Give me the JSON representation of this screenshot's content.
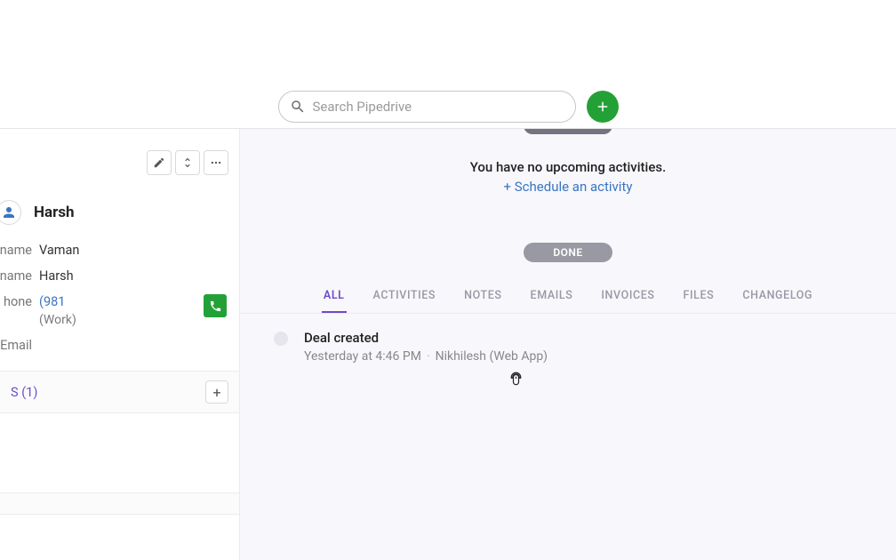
{
  "search": {
    "placeholder": "Search Pipedrive"
  },
  "person": {
    "name": "Harsh",
    "fields": {
      "name1_label": "name",
      "name1_value": "Vaman",
      "name2_label": "name",
      "name2_value": "Harsh",
      "phone_label": "hone",
      "phone_value": "(981",
      "phone_type": "(Work)",
      "email_label": "Email"
    }
  },
  "deals_section": {
    "title": "S (1)"
  },
  "main": {
    "empty_text": "You have no upcoming activities.",
    "schedule_link": "+ Schedule an activity",
    "done_label": "DONE",
    "tabs": {
      "all": "ALL",
      "activities": "ACTIVITIES",
      "notes": "NOTES",
      "emails": "EMAILS",
      "invoices": "INVOICES",
      "files": "FILES",
      "changelog": "CHANGELOG"
    },
    "event": {
      "title": "Deal created",
      "timestamp": "Yesterday at 4:46 PM",
      "actor": "Nikhilesh (Web App)"
    }
  }
}
